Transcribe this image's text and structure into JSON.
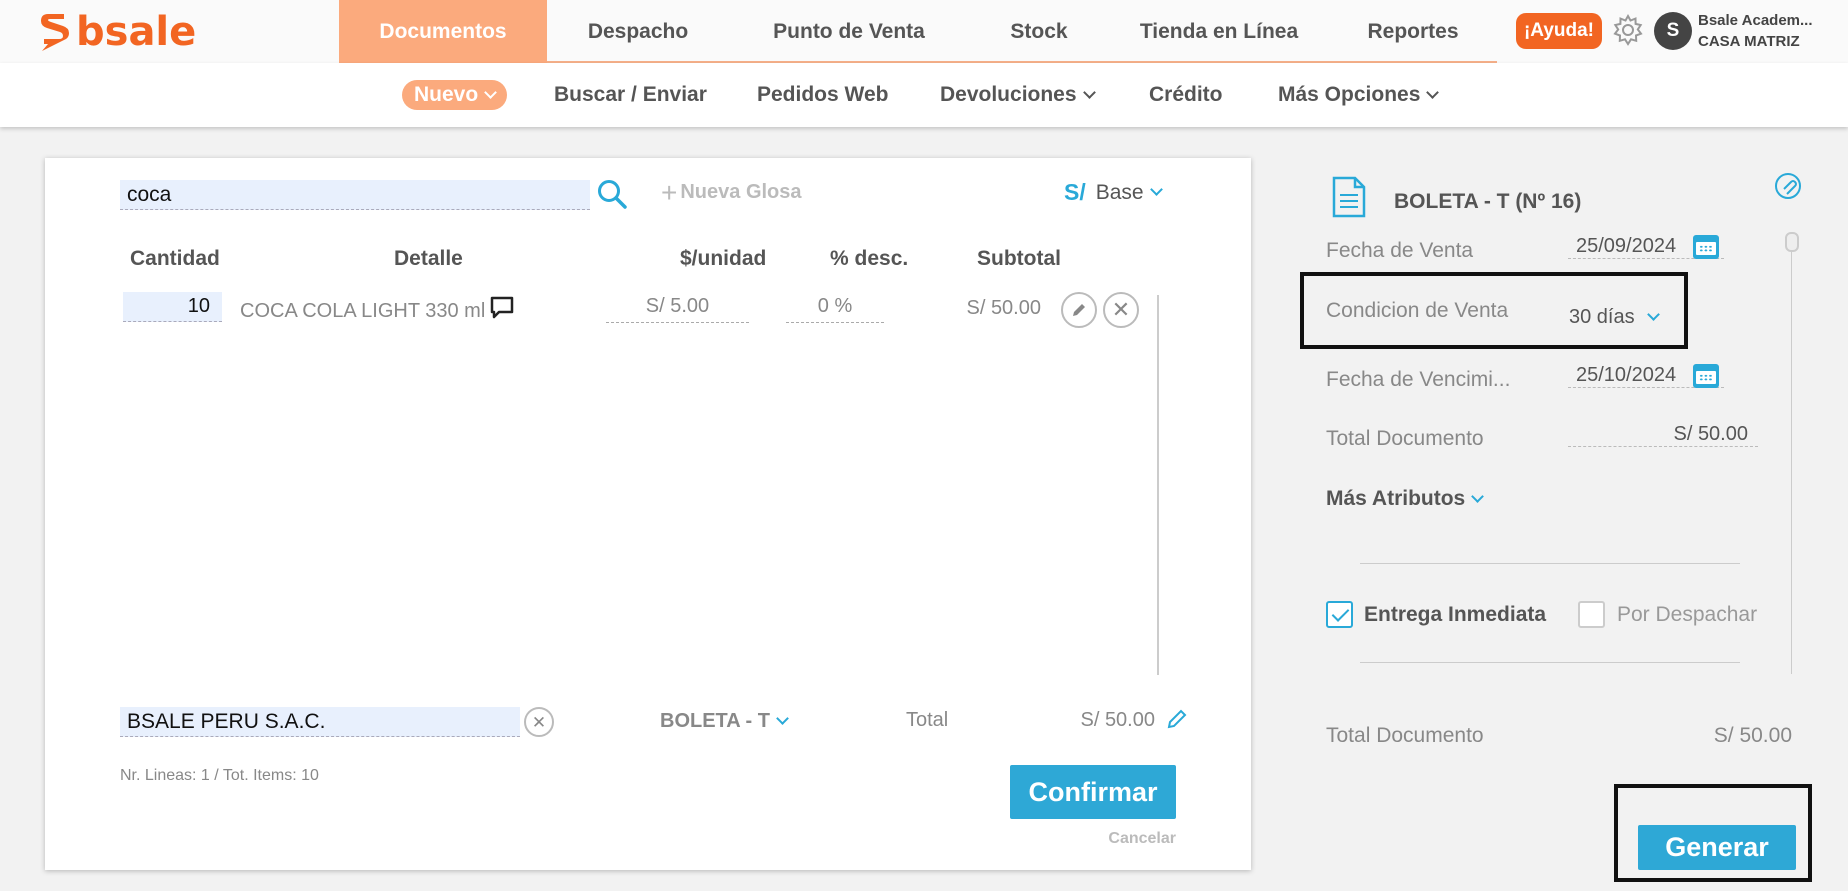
{
  "app": {
    "logo_text": "bsale",
    "brand_color": "#f26522",
    "accent_color": "#29a9d8",
    "active_nav_color": "#fbaa7d"
  },
  "main_nav": [
    {
      "label": "Documentos",
      "active": true
    },
    {
      "label": "Despacho"
    },
    {
      "label": "Punto de Venta"
    },
    {
      "label": "Stock"
    },
    {
      "label": "Tienda en Línea"
    },
    {
      "label": "Reportes"
    }
  ],
  "header": {
    "help_label": "¡Ayuda!",
    "avatar_initial": "S",
    "user_name": "Bsale Academ...",
    "branch": "CASA MATRIZ"
  },
  "sub_nav": {
    "nuevo": "Nuevo",
    "buscar": "Buscar / Enviar",
    "pedidos": "Pedidos Web",
    "devoluciones": "Devoluciones",
    "credito": "Crédito",
    "mas": "Más Opciones"
  },
  "editor": {
    "search_value": "coca",
    "nueva_glosa": "Nueva Glosa",
    "currency_symbol": "S/",
    "price_list": "Base",
    "columns": {
      "cantidad": "Cantidad",
      "detalle": "Detalle",
      "unit": "$/unidad",
      "desc": "% desc.",
      "subtotal": "Subtotal"
    },
    "rows": [
      {
        "cantidad": "10",
        "detalle": "COCA COLA LIGHT 330 ml",
        "unit": "S/ 5.00",
        "desc": "0 %",
        "subtotal": "S/ 50.00"
      }
    ],
    "client_value": "BSALE PERU S.A.C.",
    "doc_type": "BOLETA - T",
    "total_label": "Total",
    "total_value": "S/ 50.00",
    "summary": "Nr. Lineas: 1 / Tot. Items: 10",
    "confirm_label": "Confirmar",
    "cancel_label": "Cancelar"
  },
  "sidebar": {
    "doc_title": "BOLETA - T (Nº 16)",
    "fecha_venta_label": "Fecha de Venta",
    "fecha_venta": "25/09/2024",
    "condicion_label": "Condicion de Venta",
    "condicion": "30 días",
    "vencimiento_label": "Fecha de Vencimi...",
    "vencimiento": "25/10/2024",
    "total_doc_label": "Total Documento",
    "total_doc": "S/ 50.00",
    "mas_atributos": "Más Atributos",
    "entrega_inmediata": "Entrega Inmediata",
    "entrega_checked": true,
    "por_despachar": "Por Despachar",
    "despachar_checked": false,
    "bottom_total_label": "Total Documento",
    "bottom_total": "S/ 50.00",
    "generar_label": "Generar"
  }
}
